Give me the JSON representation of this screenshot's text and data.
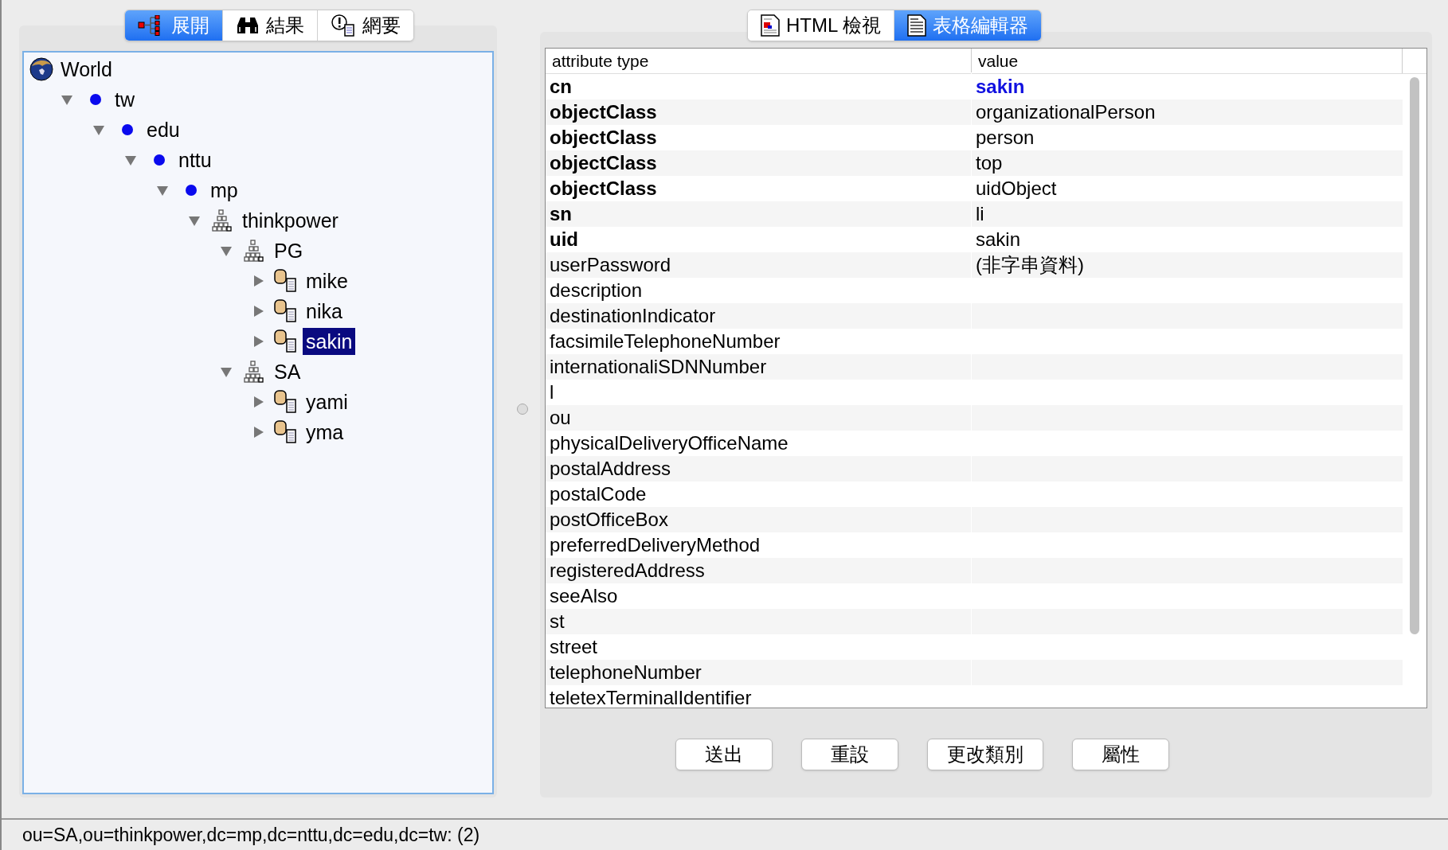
{
  "left_tabs": [
    {
      "label": "展開",
      "kind": "tree",
      "selected": true
    },
    {
      "label": "結果",
      "kind": "binoculars",
      "selected": false
    },
    {
      "label": "網要",
      "kind": "schema",
      "selected": false
    }
  ],
  "tree": [
    {
      "label": "World",
      "kind": "root",
      "selected": false,
      "children": [
        {
          "label": "tw",
          "kind": "dc",
          "expanded": true,
          "selected": false,
          "children": [
            {
              "label": "edu",
              "kind": "dc",
              "expanded": true,
              "selected": false,
              "children": [
                {
                  "label": "nttu",
                  "kind": "dc",
                  "expanded": true,
                  "selected": false,
                  "children": [
                    {
                      "label": "mp",
                      "kind": "dc",
                      "expanded": true,
                      "selected": false,
                      "children": [
                        {
                          "label": "thinkpower",
                          "kind": "ou",
                          "expanded": true,
                          "selected": false,
                          "children": [
                            {
                              "label": "PG",
                              "kind": "ou",
                              "expanded": true,
                              "selected": false,
                              "children": [
                                {
                                  "label": "mike",
                                  "kind": "person",
                                  "expanded": false,
                                  "selected": false
                                },
                                {
                                  "label": "nika",
                                  "kind": "person",
                                  "expanded": false,
                                  "selected": false
                                },
                                {
                                  "label": "sakin",
                                  "kind": "person",
                                  "expanded": false,
                                  "selected": true
                                }
                              ]
                            },
                            {
                              "label": "SA",
                              "kind": "ou",
                              "expanded": true,
                              "selected": false,
                              "children": [
                                {
                                  "label": "yami",
                                  "kind": "person",
                                  "expanded": false,
                                  "selected": false
                                },
                                {
                                  "label": "yma",
                                  "kind": "person",
                                  "expanded": false,
                                  "selected": false
                                }
                              ]
                            }
                          ]
                        }
                      ]
                    }
                  ]
                }
              ]
            }
          ]
        }
      ]
    }
  ],
  "right_tabs": [
    {
      "label": "HTML 檢視",
      "kind": "html",
      "selected": false
    },
    {
      "label": "表格編輯器",
      "kind": "table",
      "selected": true
    }
  ],
  "table": {
    "columns": [
      "attribute type",
      "value"
    ],
    "rows": [
      {
        "attribute": "cn",
        "value": "sakin",
        "required": true,
        "naming": true
      },
      {
        "attribute": "objectClass",
        "value": "organizationalPerson",
        "required": true,
        "naming": false
      },
      {
        "attribute": "objectClass",
        "value": "person",
        "required": true,
        "naming": false
      },
      {
        "attribute": "objectClass",
        "value": "top",
        "required": true,
        "naming": false
      },
      {
        "attribute": "objectClass",
        "value": "uidObject",
        "required": true,
        "naming": false
      },
      {
        "attribute": "sn",
        "value": "li",
        "required": true,
        "naming": false
      },
      {
        "attribute": "uid",
        "value": "sakin",
        "required": true,
        "naming": false
      },
      {
        "attribute": "userPassword",
        "value": "(非字串資料)",
        "required": false,
        "naming": false
      },
      {
        "attribute": "description",
        "required": false
      },
      {
        "attribute": "destinationIndicator",
        "required": false
      },
      {
        "attribute": "facsimileTelephoneNumber",
        "required": false
      },
      {
        "attribute": "internationaliSDNNumber",
        "required": false
      },
      {
        "attribute": "l",
        "required": false
      },
      {
        "attribute": "ou",
        "required": false
      },
      {
        "attribute": "physicalDeliveryOfficeName",
        "required": false
      },
      {
        "attribute": "postalAddress",
        "required": false
      },
      {
        "attribute": "postalCode",
        "required": false
      },
      {
        "attribute": "postOfficeBox",
        "required": false
      },
      {
        "attribute": "preferredDeliveryMethod",
        "required": false
      },
      {
        "attribute": "registeredAddress",
        "required": false
      },
      {
        "attribute": "seeAlso",
        "required": false
      },
      {
        "attribute": "st",
        "required": false
      },
      {
        "attribute": "street",
        "required": false
      },
      {
        "attribute": "telephoneNumber",
        "required": false
      },
      {
        "attribute": "teletexTerminalIdentifier",
        "required": false
      }
    ]
  },
  "buttons": [
    "送出",
    "重設",
    "更改類別",
    "屬性"
  ],
  "status_bar": "ou=SA,ou=thinkpower,dc=mp,dc=nttu,dc=edu,dc=tw: (2)"
}
